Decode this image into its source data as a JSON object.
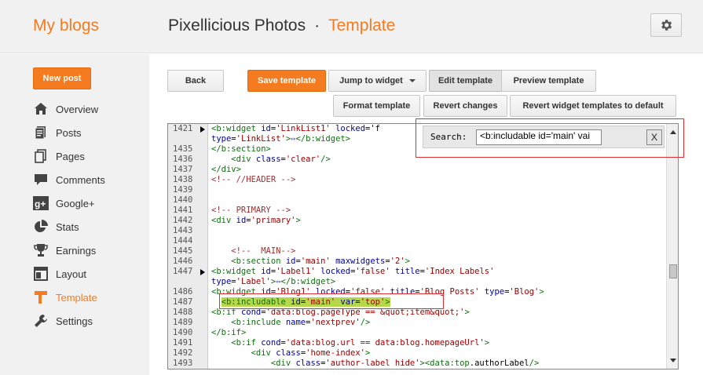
{
  "header": {
    "brand": "My blogs",
    "blog_name": "Pixellicious Photos",
    "separator": "·",
    "page_name": "Template"
  },
  "sidebar": {
    "new_post": "New post",
    "items": [
      {
        "label": "Overview",
        "icon": "overview-icon"
      },
      {
        "label": "Posts",
        "icon": "posts-icon"
      },
      {
        "label": "Pages",
        "icon": "pages-icon"
      },
      {
        "label": "Comments",
        "icon": "comments-icon"
      },
      {
        "label": "Google+",
        "icon": "google-plus-icon"
      },
      {
        "label": "Stats",
        "icon": "stats-icon"
      },
      {
        "label": "Earnings",
        "icon": "earnings-icon"
      },
      {
        "label": "Layout",
        "icon": "layout-icon"
      },
      {
        "label": "Template",
        "icon": "template-icon",
        "active": true
      },
      {
        "label": "Settings",
        "icon": "settings-icon"
      }
    ]
  },
  "toolbar": {
    "back": "Back",
    "save": "Save template",
    "jump": "Jump to widget",
    "edit": "Edit template",
    "preview": "Preview template",
    "format": "Format template",
    "revert": "Revert changes",
    "revert_widgets": "Revert widget templates to default"
  },
  "search": {
    "label": "Search:",
    "value": "<b:includable id='main' vai",
    "close": "X"
  },
  "editor": {
    "lines": [
      {
        "n": "1421",
        "text": "<b:widget id='LinkList1' locked='f",
        "marker": true
      },
      {
        "n": "",
        "text": "type='LinkList'>↔</b:widget>"
      },
      {
        "n": "1435",
        "text": "</b:section>"
      },
      {
        "n": "1436",
        "text": "    <div class='clear'/>"
      },
      {
        "n": "1437",
        "text": "</div>"
      },
      {
        "n": "1438",
        "text": "<!-- //HEADER -->"
      },
      {
        "n": "1439",
        "text": ""
      },
      {
        "n": "1440",
        "text": ""
      },
      {
        "n": "1441",
        "text": "<!-- PRIMARY -->"
      },
      {
        "n": "1442",
        "text": "<div id='primary'>"
      },
      {
        "n": "1443",
        "text": ""
      },
      {
        "n": "1444",
        "text": ""
      },
      {
        "n": "1445",
        "text": "    <!--  MAIN-->"
      },
      {
        "n": "1446",
        "text": "    <b:section id='main' maxwidgets='2'>"
      },
      {
        "n": "1447",
        "text": "<b:widget id='Label1' locked='false' title='Index Labels'",
        "marker": true
      },
      {
        "n": "",
        "text": "type='Label'>↔</b:widget>"
      },
      {
        "n": "1486",
        "text": "<b:widget id='Blog1' locked='false' title='Blog Posts' type='Blog'>"
      },
      {
        "n": "1487",
        "text": "  <b:includable id='main' var='top'>"
      },
      {
        "n": "1488",
        "text": "<b:if cond='data:blog.pageType == &quot;item&quot;'>"
      },
      {
        "n": "1489",
        "text": "    <b:include name='nextprev'/>"
      },
      {
        "n": "1490",
        "text": "</b:if>"
      },
      {
        "n": "1491",
        "text": "    <b:if cond='data:blog.url == data:blog.homepageUrl'>"
      },
      {
        "n": "1492",
        "text": "        <div class='home-index'>"
      },
      {
        "n": "1493",
        "text": "            <div class='author-label hide'><data:top.authorLabel/>"
      }
    ]
  }
}
